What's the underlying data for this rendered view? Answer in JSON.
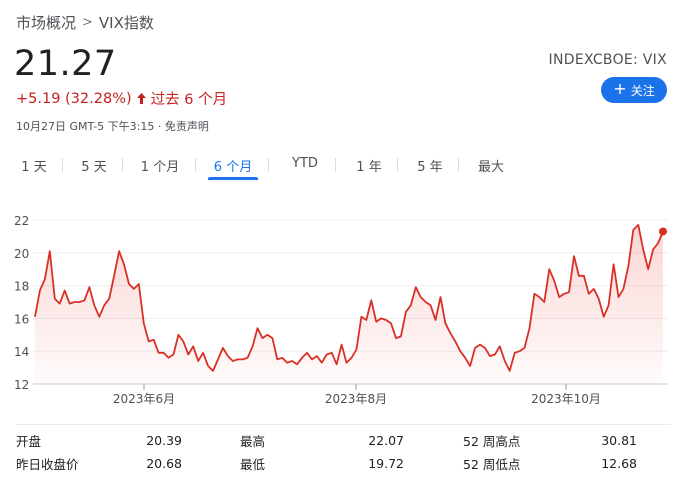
{
  "breadcrumb": {
    "parent": "市场概况",
    "separator": ">",
    "current": "VIX指数"
  },
  "quote": {
    "price": "21.27",
    "change": "+5.19 (32.28%)",
    "period": "过去 6 个月",
    "timestamp": "10月27日 GMT-5 下午3:15 · 免责声明",
    "ticker": "INDEXCBOE: VIX",
    "follow_label": "关注"
  },
  "colors": {
    "down_red": "#c5221f",
    "line": "#d93025",
    "accent": "#1a73e8"
  },
  "tabs": [
    {
      "label": "1 天"
    },
    {
      "label": "5 天"
    },
    {
      "label": "1 个月"
    },
    {
      "label": "6 个月",
      "active": true
    },
    {
      "label": "YTD"
    },
    {
      "label": "1 年"
    },
    {
      "label": "5 年"
    },
    {
      "label": "最大"
    }
  ],
  "stats": {
    "open_label": "开盘",
    "open": "20.39",
    "high_label": "最高",
    "high": "22.07",
    "high52_label": "52 周高点",
    "high52": "30.81",
    "prev_close_label": "昨日收盘价",
    "prev_close": "20.68",
    "low_label": "最低",
    "low": "19.72",
    "low52_label": "52 周低点",
    "low52": "12.68"
  },
  "chart_data": {
    "type": "area",
    "ylim": [
      12,
      22
    ],
    "y_ticks": [
      12,
      14,
      16,
      18,
      20,
      22
    ],
    "x_tick_labels": [
      "2023年6月",
      "2023年8月",
      "2023年10月"
    ],
    "grid": true,
    "series": [
      {
        "values": [
          16.1,
          17.7,
          18.4,
          20.1,
          17.2,
          16.9,
          17.7,
          16.9,
          17.0,
          17.0,
          17.1,
          17.9,
          16.8,
          16.1,
          16.8,
          17.2,
          18.6,
          20.1,
          19.3,
          18.1,
          17.8,
          18.1,
          15.7,
          14.6,
          14.7,
          13.9,
          13.9,
          13.6,
          13.8,
          15.0,
          14.6,
          13.8,
          14.3,
          13.4,
          13.9,
          13.1,
          12.8,
          13.5,
          14.2,
          13.7,
          13.4,
          13.5,
          13.5,
          13.6,
          14.3,
          15.4,
          14.8,
          15.0,
          14.8,
          13.5,
          13.6,
          13.3,
          13.4,
          13.2,
          13.6,
          13.9,
          13.5,
          13.7,
          13.3,
          13.8,
          13.9,
          13.2,
          14.4,
          13.3,
          13.6,
          14.1,
          16.1,
          15.9,
          17.1,
          15.8,
          16.0,
          15.9,
          15.7,
          14.8,
          14.9,
          16.4,
          16.8,
          17.9,
          17.3,
          17.0,
          16.8,
          15.9,
          17.3,
          15.7,
          15.1,
          14.6,
          14.0,
          13.6,
          13.1,
          14.2,
          14.4,
          14.2,
          13.7,
          13.8,
          14.3,
          13.4,
          12.8,
          13.9,
          14.0,
          14.2,
          15.4,
          17.5,
          17.3,
          17.0,
          19.0,
          18.3,
          17.3,
          17.5,
          17.6,
          19.8,
          18.6,
          18.6,
          17.5,
          17.8,
          17.2,
          16.1,
          16.8,
          19.3,
          17.3,
          17.8,
          19.2,
          21.4,
          21.7,
          20.2,
          19.0,
          20.2,
          20.6,
          21.3
        ]
      }
    ]
  }
}
